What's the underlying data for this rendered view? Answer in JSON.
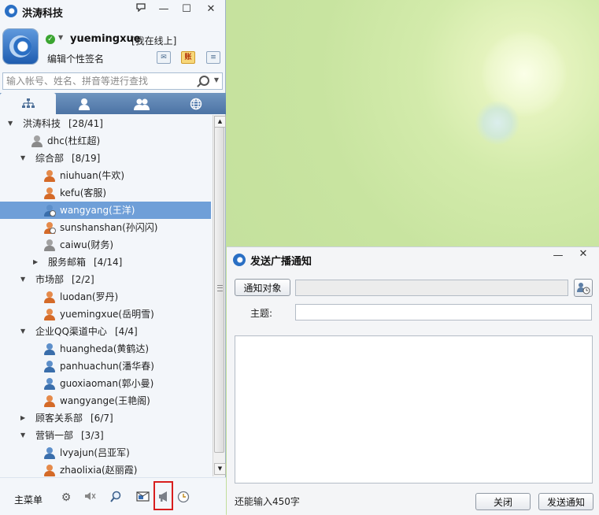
{
  "main_window": {
    "title": "洪涛科技",
    "buttons": {
      "feedback_icon": "speech-bubble-icon",
      "minimize": "—",
      "maximize": "☐",
      "close": "✕"
    }
  },
  "profile": {
    "username": "yuemingxue",
    "status": "[我在线上]",
    "signature": "编辑个性签名",
    "status_color": "#3ba531"
  },
  "search": {
    "placeholder": "输入帐号、姓名、拼音等进行查找"
  },
  "tabs": [
    "organization-icon",
    "contact-icon",
    "group-icon",
    "internet-icon"
  ],
  "tree": [
    {
      "kind": "group",
      "depth": 0,
      "expanded": true,
      "name": "洪涛科技",
      "count": "[28/41]"
    },
    {
      "kind": "user",
      "depth": 1,
      "color": "gray",
      "label": "dhc(杜红超)"
    },
    {
      "kind": "group",
      "depth": 1,
      "expanded": true,
      "name": "综合部",
      "count": "[8/19]"
    },
    {
      "kind": "user",
      "depth": 2,
      "color": "orange",
      "label": "niuhuan(牛欢)"
    },
    {
      "kind": "user",
      "depth": 2,
      "color": "orange",
      "label": "kefu(客服)"
    },
    {
      "kind": "user",
      "depth": 2,
      "color": "blue",
      "clock": true,
      "selected": true,
      "label": "wangyang(王洋)"
    },
    {
      "kind": "user",
      "depth": 2,
      "color": "orange",
      "clock": true,
      "label": "sunshanshan(孙闪闪)"
    },
    {
      "kind": "user",
      "depth": 2,
      "color": "gray",
      "label": "caiwu(财务)"
    },
    {
      "kind": "group",
      "depth": 2,
      "expanded": false,
      "name": "服务邮箱",
      "count": "[4/14]"
    },
    {
      "kind": "group",
      "depth": 1,
      "expanded": true,
      "name": "市场部",
      "count": "[2/2]"
    },
    {
      "kind": "user",
      "depth": 2,
      "color": "orange",
      "label": "luodan(罗丹)"
    },
    {
      "kind": "user",
      "depth": 2,
      "color": "orange",
      "label": "yuemingxue(岳明雪)"
    },
    {
      "kind": "group",
      "depth": 1,
      "expanded": true,
      "name": "企业QQ渠道中心",
      "count": "[4/4]"
    },
    {
      "kind": "user",
      "depth": 2,
      "color": "blue",
      "label": "huangheda(黄鹤达)"
    },
    {
      "kind": "user",
      "depth": 2,
      "color": "blue",
      "label": "panhuachun(潘华春)"
    },
    {
      "kind": "user",
      "depth": 2,
      "color": "blue",
      "label": "guoxiaoman(郭小曼)"
    },
    {
      "kind": "user",
      "depth": 2,
      "color": "orange",
      "label": "wangyange(王艳阁)"
    },
    {
      "kind": "group",
      "depth": 1,
      "expanded": false,
      "name": "顾客关系部",
      "count": "[6/7]"
    },
    {
      "kind": "group",
      "depth": 1,
      "expanded": true,
      "name": "营销一部",
      "count": "[3/3]"
    },
    {
      "kind": "user",
      "depth": 2,
      "color": "blue",
      "label": "lvyajun(吕亚军)"
    },
    {
      "kind": "user",
      "depth": 2,
      "color": "orange",
      "label": "zhaolixia(赵丽霞)"
    }
  ],
  "bottom_bar": {
    "main_menu": "主菜单",
    "icons": [
      "settings-gear-icon",
      "speaker-icon",
      "search-magnifier-icon",
      "message-box-icon",
      "broadcast-megaphone-icon",
      "history-clock-icon"
    ]
  },
  "dialog": {
    "title": "发送广播通知",
    "target_button": "通知对象",
    "subject_label": "主题:",
    "subject_value": "",
    "body_value": "",
    "remaining": "还能输入450字",
    "close_button": "关闭",
    "send_button": "发送通知"
  },
  "colors": {
    "selection": "#6f9fd8",
    "tab_bar": "#5b81b1",
    "highlight": "#d81e1e",
    "background": "#c8e4a0"
  }
}
